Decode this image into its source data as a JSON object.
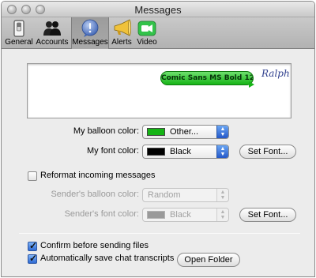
{
  "window": {
    "title": "Messages"
  },
  "toolbar": {
    "items": [
      {
        "label": "General",
        "icon": "general-switch-icon"
      },
      {
        "label": "Accounts",
        "icon": "accounts-people-icon"
      },
      {
        "label": "Messages",
        "icon": "messages-bubble-icon",
        "selected": true
      },
      {
        "label": "Alerts",
        "icon": "megaphone-icon"
      },
      {
        "label": "Video",
        "icon": "video-camera-icon"
      }
    ]
  },
  "preview": {
    "balloon_text": "Comic Sans MS Bold 12",
    "signature": "Ralph",
    "balloon_color": "#18b418"
  },
  "form": {
    "balloon_color_label": "My balloon color:",
    "balloon_color_value": "Other...",
    "balloon_swatch": "#15b415",
    "font_color_label": "My font color:",
    "font_color_value": "Black",
    "font_swatch": "#000000",
    "set_font_label": "Set Font...",
    "reformat_label": "Reformat incoming messages",
    "reformat_checked": false,
    "sender_balloon_label": "Sender's balloon color:",
    "sender_balloon_value": "Random",
    "sender_font_label": "Sender's font color:",
    "sender_font_value": "Black",
    "sender_font_swatch": "#9a9a9a",
    "sender_set_font_label": "Set Font...",
    "confirm_files_label": "Confirm before sending files",
    "confirm_files_checked": true,
    "autosave_label": "Automatically save chat transcripts",
    "autosave_checked": true,
    "open_folder_label": "Open Folder"
  },
  "colors": {
    "accent": "#2f6ad4"
  }
}
